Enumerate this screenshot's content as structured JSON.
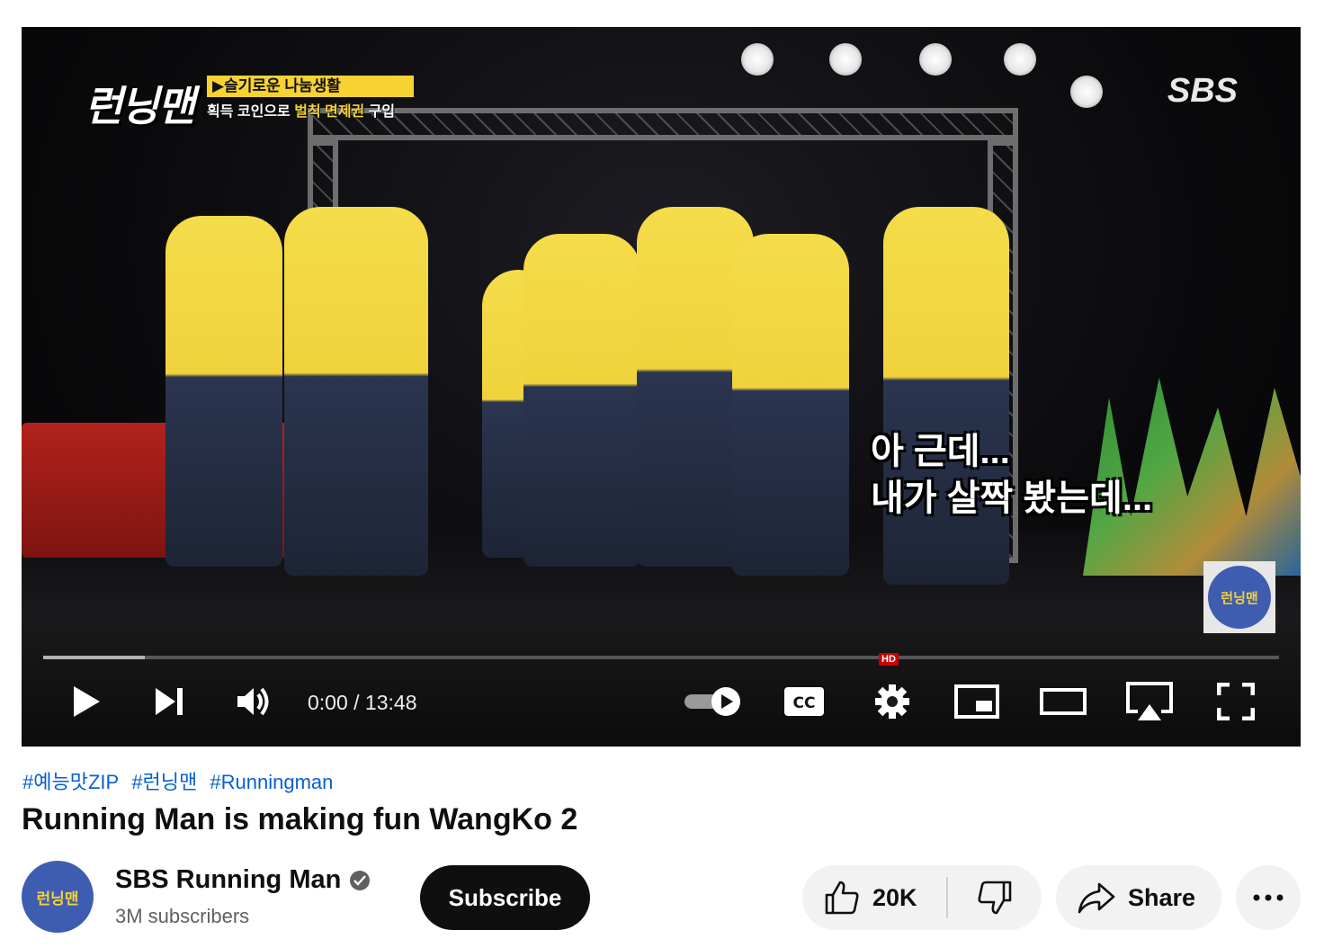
{
  "video": {
    "overlay": {
      "show_logo": "런닝맨",
      "banner_top": "▶슬기로운 나눔생활",
      "banner_bottom_white": "획득 코인으로 ",
      "banner_bottom_yellow": "벌칙 면제권",
      "banner_bottom_end": " 구입",
      "broadcaster": "SBS",
      "subtitle_line1": "아 근데...",
      "subtitle_line2": "내가 살짝 봤는데...",
      "watermark": "런닝맨"
    },
    "progress": {
      "played_fraction": 0.0,
      "buffered_fraction": 0.082
    },
    "time_display": "0:00 / 13:48",
    "quality_badge": "HD",
    "controls": [
      "play-icon",
      "next-icon",
      "volume-icon",
      "autoplay-toggle",
      "cc-icon",
      "settings-icon",
      "miniplayer-icon",
      "theater-icon",
      "airplay-icon",
      "fullscreen-icon"
    ]
  },
  "hashtags": [
    "#예능맛ZIP",
    "#런닝맨",
    "#Runningman"
  ],
  "title": "Running Man is making fun WangKo 2",
  "channel": {
    "avatar_text": "런닝맨",
    "name": "SBS Running Man",
    "verified": true,
    "subscribers": "3M subscribers"
  },
  "actions": {
    "subscribe_label": "Subscribe",
    "like_count": "20K",
    "share_label": "Share"
  },
  "colors": {
    "link": "#065fd4",
    "subscribe_bg": "#0f0f0f",
    "pill_bg": "#f2f2f2",
    "progress_red": "#ff0000",
    "shirt_yellow": "#f6d233"
  }
}
